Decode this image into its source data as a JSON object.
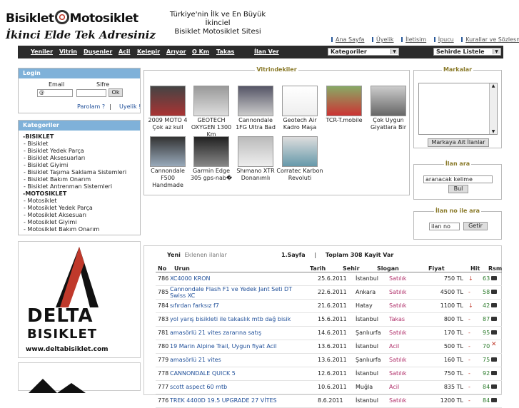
{
  "logo": {
    "brand_left": "Bisiklet",
    "brand_right": "Motosiklet",
    "slogan": "İkinci Elde Tek Adresiniz"
  },
  "tagline": {
    "line1": "Türkiye'nin İlk ve En Büyük",
    "line2": "İkinciel",
    "line3": "Bisiklet Motosiklet Sitesi"
  },
  "top_links": [
    "Ana Sayfa",
    "Üyelik",
    "İletisim",
    "İpucu",
    "Kurallar ve Sözlesme"
  ],
  "nav": {
    "links": [
      "Yeniler",
      "Vitrin",
      "Duşenler",
      "Acil",
      "Kelepir",
      "Arıyor",
      "O Km",
      "Takas",
      "İlan Ver"
    ],
    "category_select": "Kategoriler",
    "city_select": "Sehirde Listele"
  },
  "login": {
    "title": "Login",
    "email_label": "Email",
    "password_label": "Sifre",
    "email_value": "@",
    "ok": "Ok",
    "forgot": "Parolam ?",
    "separator": "|",
    "signup": "Uyelik !"
  },
  "categories": {
    "title": "Kategoriler",
    "items": [
      {
        "label": "-BISIKLET",
        "bold": true
      },
      {
        "label": "- Bisiklet"
      },
      {
        "label": "- Bisiklet Yedek Parça"
      },
      {
        "label": "- Bisiklet Aksesuarları"
      },
      {
        "label": "- Bisiklet Giyimi"
      },
      {
        "label": "- Bisiklet Taşıma Saklama Sistemleri"
      },
      {
        "label": "- Bisiklet Bakım Onarım"
      },
      {
        "label": "- Bisiklet Antrenman Sistemleri"
      },
      {
        "label": "-MOTOSIKLET",
        "bold": true
      },
      {
        "label": "- Motosiklet"
      },
      {
        "label": "- Motosiklet Yedek Parça"
      },
      {
        "label": "- Motosiklet Aksesuarı"
      },
      {
        "label": "- Motosiklet Giyimi"
      },
      {
        "label": "- Motosiklet Bakım Onarım"
      }
    ]
  },
  "ad_banner": {
    "brand": "DELTA",
    "sub": "BISIKLET",
    "url": "www.deltabisiklet.com"
  },
  "vitrin": {
    "title": "Vitrindekiler",
    "items": [
      "2009 MOTO 4 Çok az kull",
      "GEOTECH OXYGEN 1300 Km",
      "Cannondale 1FG Ultra Bad",
      "Geotech Air Kadro Maşa",
      "TCR-T.mobile",
      "Çok Uygun Giyatlara Bir",
      "Cannondale F500 Handmade",
      "Garmin Edge 305 gps-nab�",
      "Shımano XTR Donanımlı",
      "Corratec Karbon Revoluti"
    ]
  },
  "markalar": {
    "title": "Markalar",
    "button": "Markaya Ait İlanlar"
  },
  "ilan_ara": {
    "title": "İlan ara",
    "placeholder": "aranacak kelime",
    "button": "Bul"
  },
  "ilan_no": {
    "title": "İlan no ile ara",
    "placeholder": "ilan no",
    "button": "Getir"
  },
  "listing": {
    "yeni": "Yeni",
    "yeni_desc": "Eklenen ilanlar",
    "page": "1.Sayfa",
    "sep": "|",
    "total_label": "Toplam",
    "total": "308 Kayit Var",
    "columns": [
      "No",
      "Urun",
      "Tarih",
      "Sehir",
      "Slogan",
      "Fiyat",
      "Hit",
      "Rsm"
    ],
    "rows": [
      {
        "no": "786",
        "urun": "XC4000 KRON",
        "tarih": "25.6.2011",
        "sehir": "İstanbul",
        "slogan": "Satılık",
        "fiyat": "750 TL",
        "trend": "↓",
        "hit": "63",
        "rsm": "cam"
      },
      {
        "no": "785",
        "urun": "Cannondale Flash F1 ve Yedek Jant Seti DT Swiss XC",
        "tarih": "22.6.2011",
        "sehir": "Ankara",
        "slogan": "Satılık",
        "fiyat": "4500 TL",
        "trend": "-",
        "hit": "58",
        "rsm": "cam"
      },
      {
        "no": "784",
        "urun": "sıfırdan farksız f7",
        "tarih": "21.6.2011",
        "sehir": "Hatay",
        "slogan": "Satılık",
        "fiyat": "1100 TL",
        "trend": "↓",
        "hit": "42",
        "rsm": "cam"
      },
      {
        "no": "783",
        "urun": "yol yarış bisikleti ile takaslık mtb dağ bisik",
        "tarih": "15.6.2011",
        "sehir": "İstanbul",
        "slogan": "Takas",
        "fiyat": "800 TL",
        "trend": "-",
        "hit": "87",
        "rsm": "cam"
      },
      {
        "no": "781",
        "urun": "amasörlü 21 vites zararına satış",
        "tarih": "14.6.2011",
        "sehir": "Şanlıurfa",
        "slogan": "Satılık",
        "fiyat": "170 TL",
        "trend": "-",
        "hit": "95",
        "rsm": "cam"
      },
      {
        "no": "780",
        "urun": "19 Marin Alpine Trail, Uygun fiyat Acil",
        "tarih": "13.6.2011",
        "sehir": "İstanbul",
        "slogan": "Acil",
        "fiyat": "500 TL",
        "trend": "-",
        "hit": "70",
        "rsm": "x"
      },
      {
        "no": "779",
        "urun": "amasörlü 21 vites",
        "tarih": "13.6.2011",
        "sehir": "Şanlıurfa",
        "slogan": "Satılık",
        "fiyat": "160 TL",
        "trend": "-",
        "hit": "75",
        "rsm": "cam"
      },
      {
        "no": "778",
        "urun": "CANNONDALE QUICK 5",
        "tarih": "12.6.2011",
        "sehir": "İstanbul",
        "slogan": "Satılık",
        "fiyat": "750 TL",
        "trend": "-",
        "hit": "92",
        "rsm": "cam"
      },
      {
        "no": "777",
        "urun": "scott aspect 60 mtb",
        "tarih": "10.6.2011",
        "sehir": "Muğla",
        "slogan": "Acil",
        "fiyat": "835 TL",
        "trend": "-",
        "hit": "84",
        "rsm": "cam"
      },
      {
        "no": "776",
        "urun": "TREK 4400D 19.5 UPGRADE 27 VİTES",
        "tarih": "8.6.2011",
        "sehir": "İstanbul",
        "slogan": "Satılık",
        "fiyat": "1200 TL",
        "trend": "-",
        "hit": "84",
        "rsm": "cam"
      }
    ]
  },
  "colors": {
    "nav_bg": "#2b2b2b",
    "panel_head": "#7fb1d9",
    "legend": "#8a7a2a",
    "link_blue": "#1f4f99",
    "slogan_red": "#b0306a",
    "trend_red": "#c0392b"
  }
}
